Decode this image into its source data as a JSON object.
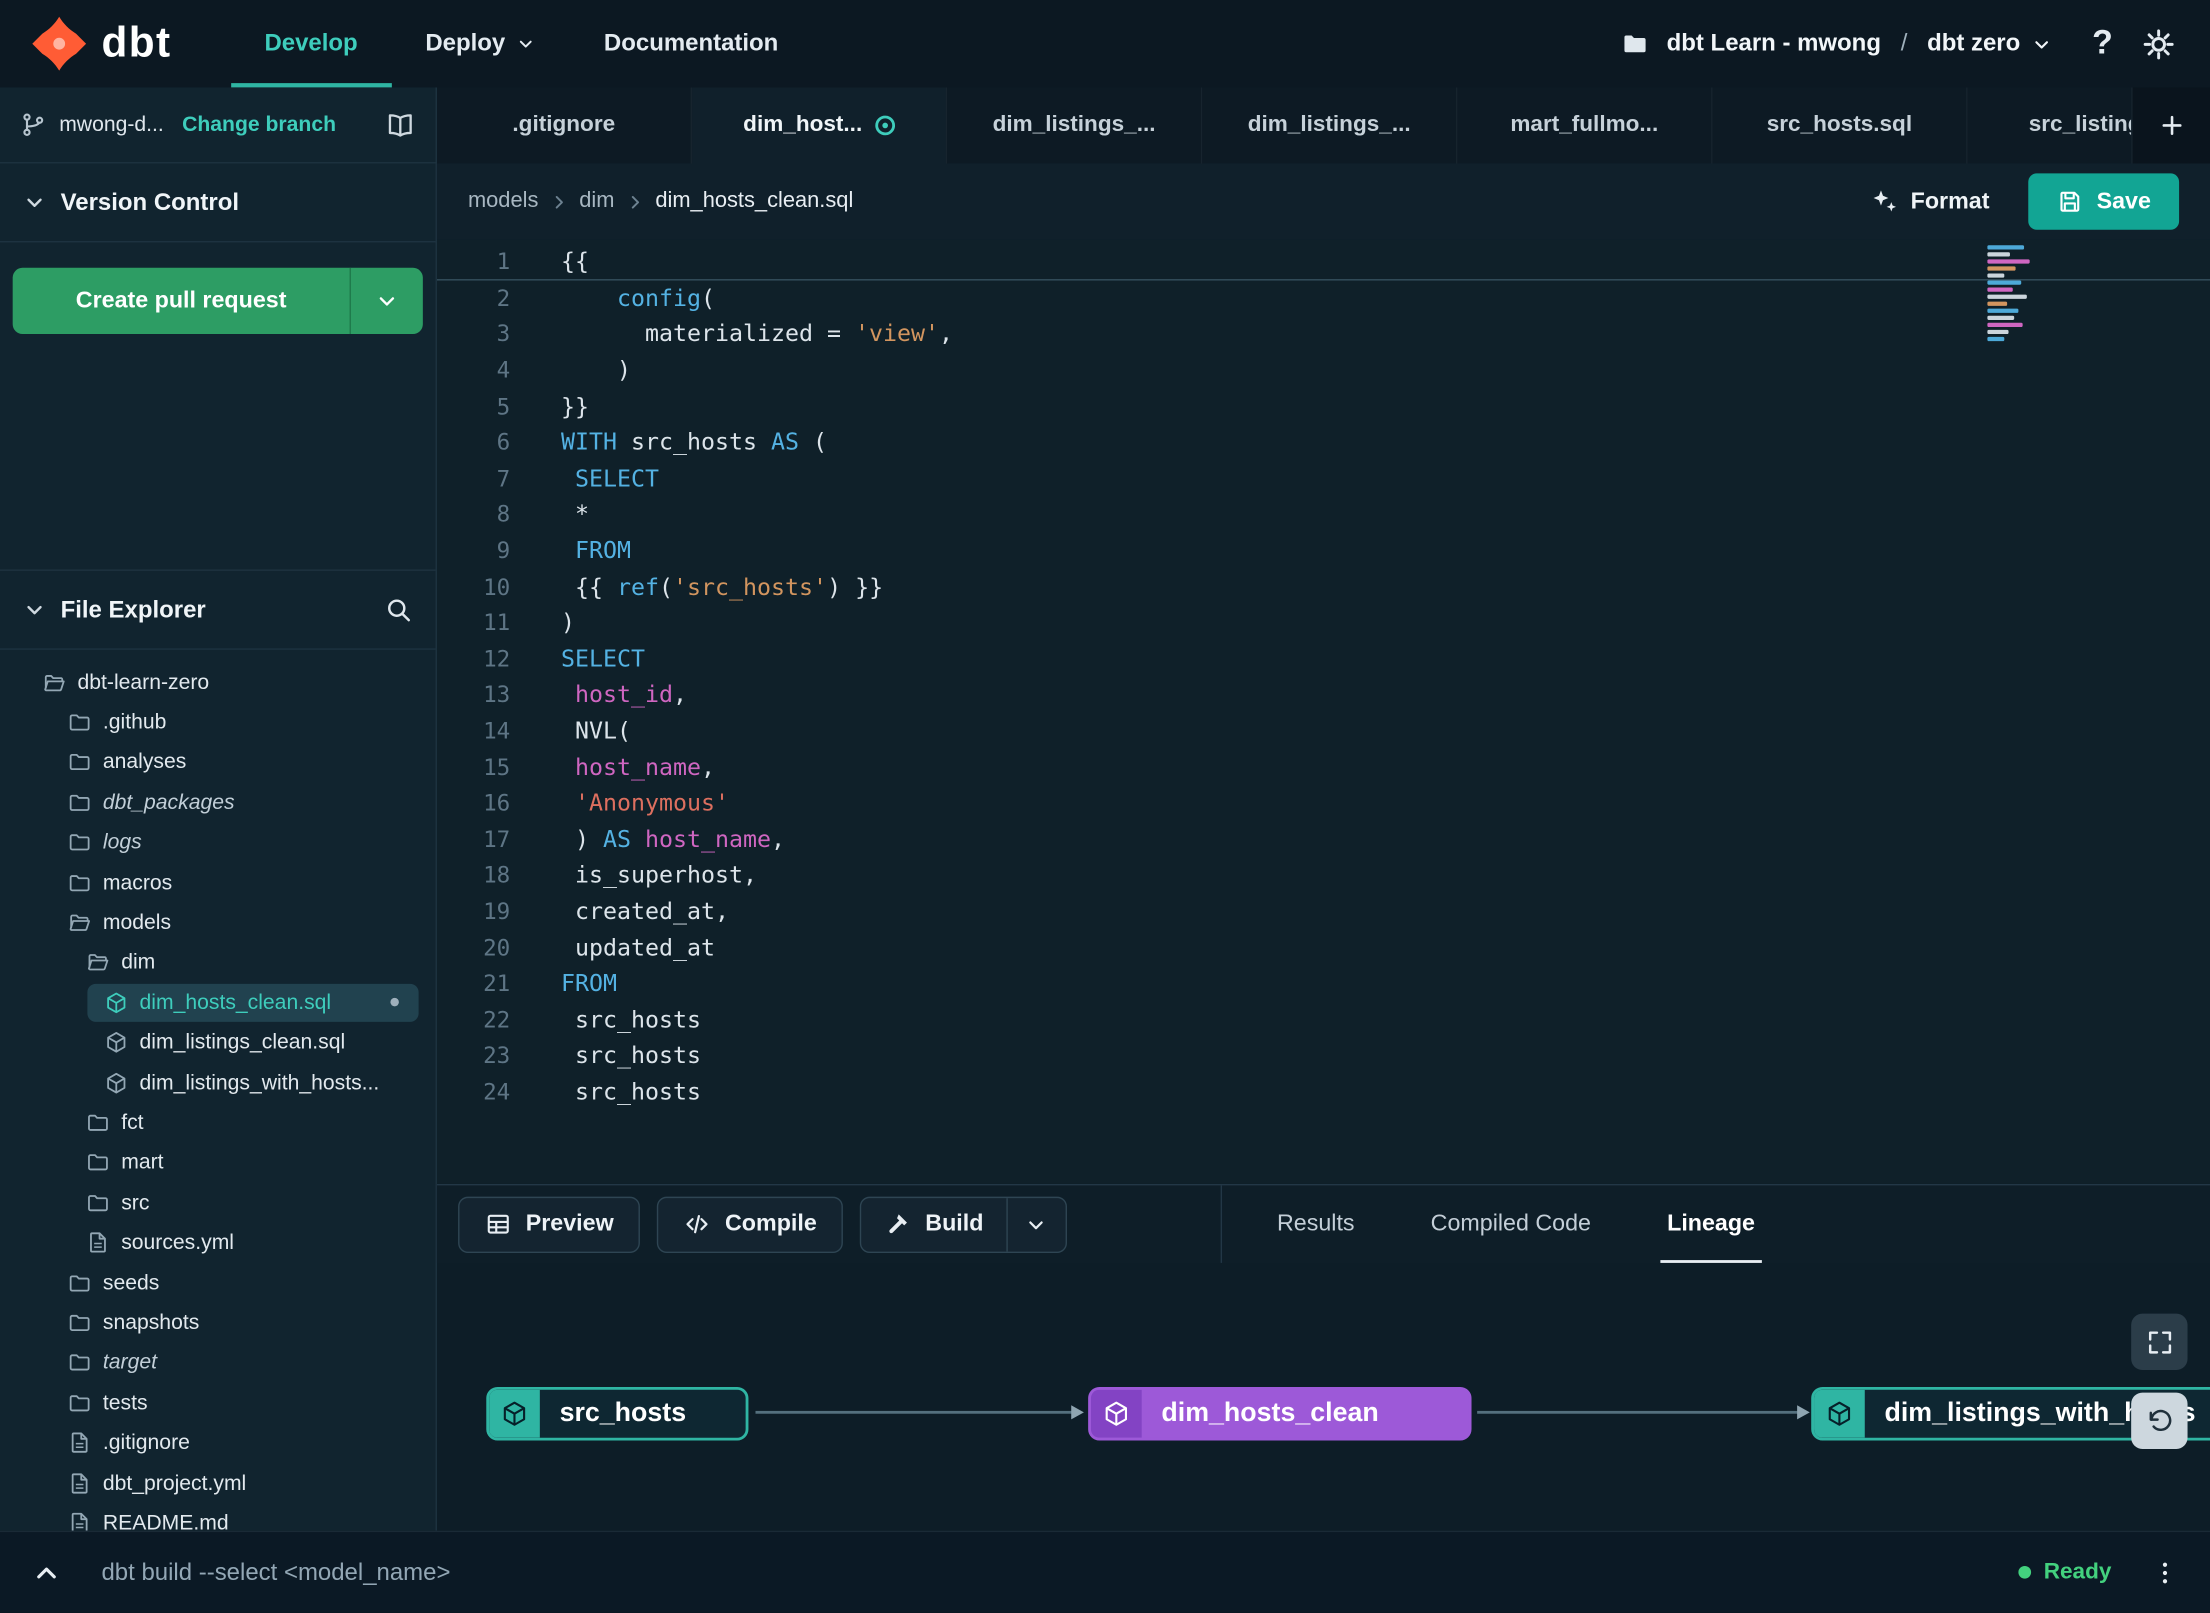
{
  "topbar": {
    "brand": "dbt",
    "nav": [
      {
        "label": "Develop",
        "active": true
      },
      {
        "label": "Deploy",
        "active": false
      },
      {
        "label": "Documentation",
        "active": false
      }
    ],
    "project": "dbt Learn - mwong",
    "separator": "/",
    "environment": "dbt zero",
    "help_glyph": "?"
  },
  "branch_bar": {
    "branch": "mwong-d...",
    "change_branch": "Change branch"
  },
  "version_control": {
    "title": "Version Control",
    "create_pr_label": "Create pull request"
  },
  "file_explorer": {
    "title": "File Explorer",
    "tree": [
      {
        "label": "dbt-learn-zero",
        "icon": "folder-open",
        "indent": 0
      },
      {
        "label": ".github",
        "icon": "folder",
        "indent": 1
      },
      {
        "label": "analyses",
        "icon": "folder",
        "indent": 1
      },
      {
        "label": "dbt_packages",
        "icon": "folder",
        "indent": 1,
        "italic": true
      },
      {
        "label": "logs",
        "icon": "folder",
        "indent": 1,
        "italic": true
      },
      {
        "label": "macros",
        "icon": "folder",
        "indent": 1
      },
      {
        "label": "models",
        "icon": "folder-open",
        "indent": 1
      },
      {
        "label": "dim",
        "icon": "folder-open",
        "indent": 2
      },
      {
        "label": "dim_hosts_clean.sql",
        "icon": "cube",
        "indent": 3,
        "selected": true,
        "modified": true
      },
      {
        "label": "dim_listings_clean.sql",
        "icon": "cube",
        "indent": 3
      },
      {
        "label": "dim_listings_with_hosts...",
        "icon": "cube",
        "indent": 3
      },
      {
        "label": "fct",
        "icon": "folder",
        "indent": 2
      },
      {
        "label": "mart",
        "icon": "folder",
        "indent": 2
      },
      {
        "label": "src",
        "icon": "folder",
        "indent": 2
      },
      {
        "label": "sources.yml",
        "icon": "file",
        "indent": 2
      },
      {
        "label": "seeds",
        "icon": "folder",
        "indent": 1
      },
      {
        "label": "snapshots",
        "icon": "folder",
        "indent": 1
      },
      {
        "label": "target",
        "icon": "folder",
        "indent": 1,
        "italic": true
      },
      {
        "label": "tests",
        "icon": "folder",
        "indent": 1
      },
      {
        "label": ".gitignore",
        "icon": "file",
        "indent": 1
      },
      {
        "label": "dbt_project.yml",
        "icon": "file",
        "indent": 1
      },
      {
        "label": "README.md",
        "icon": "file",
        "indent": 1
      }
    ]
  },
  "editor": {
    "tabs": [
      ".gitignore",
      "dim_host...",
      "dim_listings_...",
      "dim_listings_...",
      "mart_fullmo...",
      "src_hosts.sql",
      "src_listings."
    ],
    "active_tab_index": 1,
    "breadcrumb": [
      "models",
      "dim",
      "dim_hosts_clean.sql"
    ],
    "format_label": "Format",
    "save_label": "Save",
    "code_lines": [
      {
        "n": 1,
        "current": true,
        "seg": [
          [
            "p",
            "{{"
          ]
        ]
      },
      {
        "n": 2,
        "seg": [
          [
            "p",
            "    "
          ],
          [
            "k",
            "config"
          ],
          [
            "p",
            "("
          ]
        ]
      },
      {
        "n": 3,
        "seg": [
          [
            "p",
            "      materialized = "
          ],
          [
            "s",
            "'view'"
          ],
          [
            "p",
            ","
          ]
        ]
      },
      {
        "n": 4,
        "seg": [
          [
            "p",
            "    )"
          ]
        ]
      },
      {
        "n": 5,
        "seg": [
          [
            "p",
            "}}"
          ]
        ]
      },
      {
        "n": 6,
        "seg": [
          [
            "k",
            "WITH"
          ],
          [
            "p",
            " src_hosts "
          ],
          [
            "k",
            "AS"
          ],
          [
            "p",
            " ("
          ]
        ]
      },
      {
        "n": 7,
        "seg": [
          [
            "p",
            " "
          ],
          [
            "k",
            "SELECT"
          ]
        ]
      },
      {
        "n": 8,
        "seg": [
          [
            "p",
            " *"
          ]
        ]
      },
      {
        "n": 9,
        "seg": [
          [
            "p",
            " "
          ],
          [
            "k",
            "FROM"
          ]
        ]
      },
      {
        "n": 10,
        "seg": [
          [
            "p",
            " {{ "
          ],
          [
            "k",
            "ref"
          ],
          [
            "p",
            "("
          ],
          [
            "s",
            "'src_hosts'"
          ],
          [
            "p",
            ") }}"
          ]
        ]
      },
      {
        "n": 11,
        "seg": [
          [
            "p",
            ")"
          ]
        ]
      },
      {
        "n": 12,
        "seg": [
          [
            "k",
            "SELECT"
          ]
        ]
      },
      {
        "n": 13,
        "seg": [
          [
            "p",
            " "
          ],
          [
            "i",
            "host_id"
          ],
          [
            "p",
            ","
          ]
        ]
      },
      {
        "n": 14,
        "seg": [
          [
            "p",
            " NVL("
          ]
        ]
      },
      {
        "n": 15,
        "seg": [
          [
            "p",
            " "
          ],
          [
            "i",
            "host_name"
          ],
          [
            "p",
            ","
          ]
        ]
      },
      {
        "n": 16,
        "seg": [
          [
            "p",
            " "
          ],
          [
            "r",
            "'Anonymous'"
          ]
        ]
      },
      {
        "n": 17,
        "seg": [
          [
            "p",
            " ) "
          ],
          [
            "k",
            "AS"
          ],
          [
            "p",
            " "
          ],
          [
            "i",
            "host_name"
          ],
          [
            "p",
            ","
          ]
        ]
      },
      {
        "n": 18,
        "seg": [
          [
            "p",
            " is_superhost,"
          ]
        ]
      },
      {
        "n": 19,
        "seg": [
          [
            "p",
            " created_at,"
          ]
        ]
      },
      {
        "n": 20,
        "seg": [
          [
            "p",
            " updated_at"
          ]
        ]
      },
      {
        "n": 21,
        "seg": [
          [
            "k",
            "FROM"
          ]
        ]
      },
      {
        "n": 22,
        "seg": [
          [
            "p",
            " src_hosts"
          ]
        ]
      },
      {
        "n": 23,
        "seg": [
          [
            "p",
            " src_hosts"
          ]
        ]
      },
      {
        "n": 24,
        "seg": [
          [
            "p",
            " src_hosts"
          ]
        ]
      }
    ]
  },
  "bottom_panel": {
    "preview_label": "Preview",
    "compile_label": "Compile",
    "build_label": "Build",
    "tabs": [
      "Results",
      "Compiled Code",
      "Lineage"
    ],
    "active_tab": "Lineage"
  },
  "lineage": {
    "nodes": [
      {
        "label": "src_hosts",
        "variant": "model"
      },
      {
        "label": "dim_hosts_clean",
        "variant": "selected"
      },
      {
        "label": "dim_listings_with_hosts",
        "variant": "model"
      }
    ]
  },
  "status_bar": {
    "command": "dbt build --select <model_name>",
    "status": "Ready"
  },
  "colors": {
    "accent_teal": "#2fb5a3",
    "brand_orange": "#ff5c35",
    "node_purple": "#9d59d8",
    "create_pr_green": "#2d9d64",
    "save_teal": "#12a594",
    "status_green": "#43d17e"
  }
}
